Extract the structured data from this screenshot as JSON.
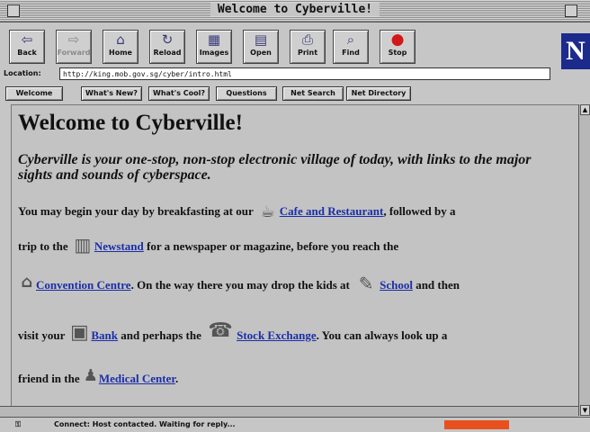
{
  "window": {
    "title": "Welcome to Cyberville!"
  },
  "toolbar": {
    "buttons": [
      {
        "label": "Back",
        "icon": "back-arrow-icon"
      },
      {
        "label": "Forward",
        "icon": "forward-arrow-icon"
      },
      {
        "label": "Home",
        "icon": "home-icon"
      },
      {
        "label": "Reload",
        "icon": "reload-icon"
      },
      {
        "label": "Images",
        "icon": "images-icon"
      },
      {
        "label": "Open",
        "icon": "open-icon"
      },
      {
        "label": "Print",
        "icon": "printer-icon"
      },
      {
        "label": "Find",
        "icon": "binoculars-icon"
      },
      {
        "label": "Stop",
        "icon": "stop-icon"
      }
    ],
    "logo_letter": "N"
  },
  "location": {
    "label": "Location:",
    "url": "http://king.mob.gov.sg/cyber/intro.html"
  },
  "directory": {
    "buttons": [
      "Welcome",
      "What's New?",
      "What's Cool?",
      "Questions",
      "Net Search",
      "Net Directory"
    ]
  },
  "content": {
    "title": "Welcome to Cyberville!",
    "intro": "Cyberville is your one-stop, non-stop electronic village of today, with links to the major sights and sounds of cyberspace.",
    "line1": {
      "pre": "You may begin your day by breakfasting at our",
      "link": "Cafe and Restaurant",
      "post": ", followed by a"
    },
    "line2": {
      "pre": "trip to the",
      "link": "Newstand",
      "post": "for a newspaper or magazine, before you reach the"
    },
    "line3": {
      "link": "Convention Centre",
      "mid": ". On the way there you may drop the kids at",
      "link2": "School",
      "post": "and then"
    },
    "line4": {
      "pre": "visit your",
      "link": "Bank",
      "mid": "and perhaps the",
      "link2": "Stock Exchange",
      "post": ". You can always look up a"
    },
    "line5": {
      "pre": "friend in the",
      "link": "Medical Center",
      "post": "."
    }
  },
  "status": {
    "text": "Connect: Host contacted. Waiting for reply..."
  }
}
